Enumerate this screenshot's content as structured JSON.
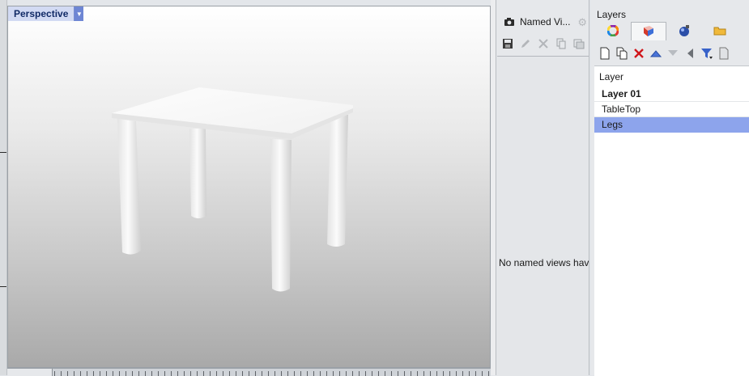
{
  "viewport": {
    "title": "Perspective",
    "object": "table"
  },
  "named_views": {
    "tab_label": "Named Vi...",
    "empty_message": "No named views hav",
    "toolbar": [
      "save-view-icon",
      "edit-view-icon",
      "delete-view-icon",
      "copy-view-icon",
      "duplicate-view-icon"
    ]
  },
  "layers": {
    "panel_title": "Layers",
    "tabs": [
      "color-wheel-icon",
      "layers-icon",
      "materials-icon",
      "folder-icon"
    ],
    "active_tab": 1,
    "toolbar": [
      "new-layer-icon",
      "new-sublayer-icon",
      "delete-layer-icon",
      "move-up-icon",
      "move-down-icon",
      "move-left-icon",
      "filter-icon",
      "document-icon"
    ],
    "column_header": "Layer",
    "items": [
      {
        "label": "Layer 01",
        "current": true,
        "selected": false
      },
      {
        "label": "TableTop",
        "current": false,
        "selected": false
      },
      {
        "label": "Legs",
        "current": false,
        "selected": true
      }
    ]
  },
  "colors": {
    "selection": "#8da4ec",
    "viewport_title_bg": "#d2daf3",
    "delete_red": "#d0161b"
  }
}
